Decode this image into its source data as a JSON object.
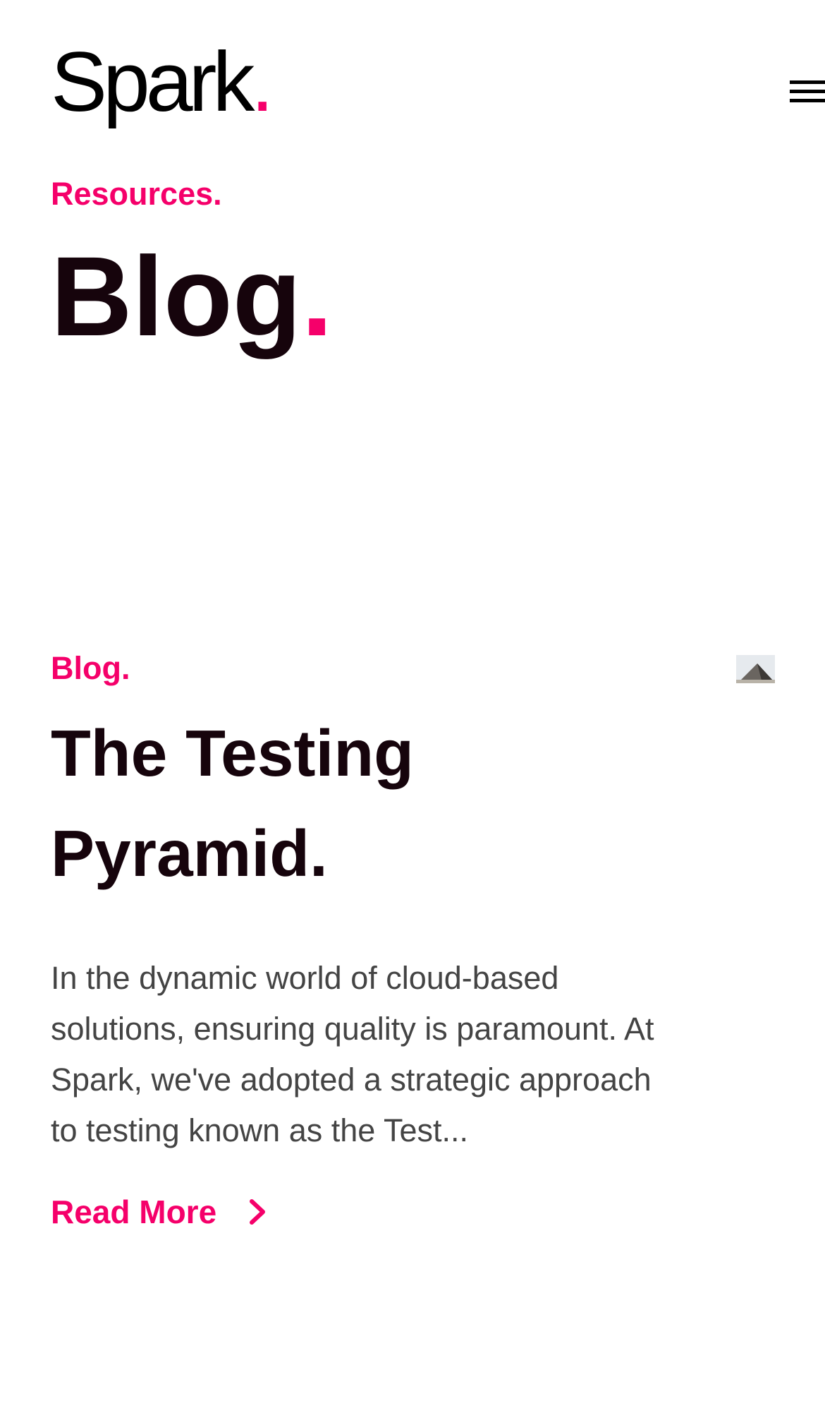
{
  "header": {
    "logo_text": "Spark",
    "logo_dot": "."
  },
  "hero": {
    "eyebrow": "Resources.",
    "title": "Blog",
    "title_dot": "."
  },
  "post": {
    "category": "Blog.",
    "title": "The Testing Pyramid.",
    "excerpt": "In the dynamic world of cloud-based solutions, ensuring quality is paramount. At Spark, we've adopted a strategic approach to testing known as the Test...",
    "read_more_label": "Read More",
    "thumbnail_icon": "pyramid-image"
  },
  "colors": {
    "accent": "#f5006a",
    "heading": "#16040c",
    "body_text": "#444444"
  }
}
